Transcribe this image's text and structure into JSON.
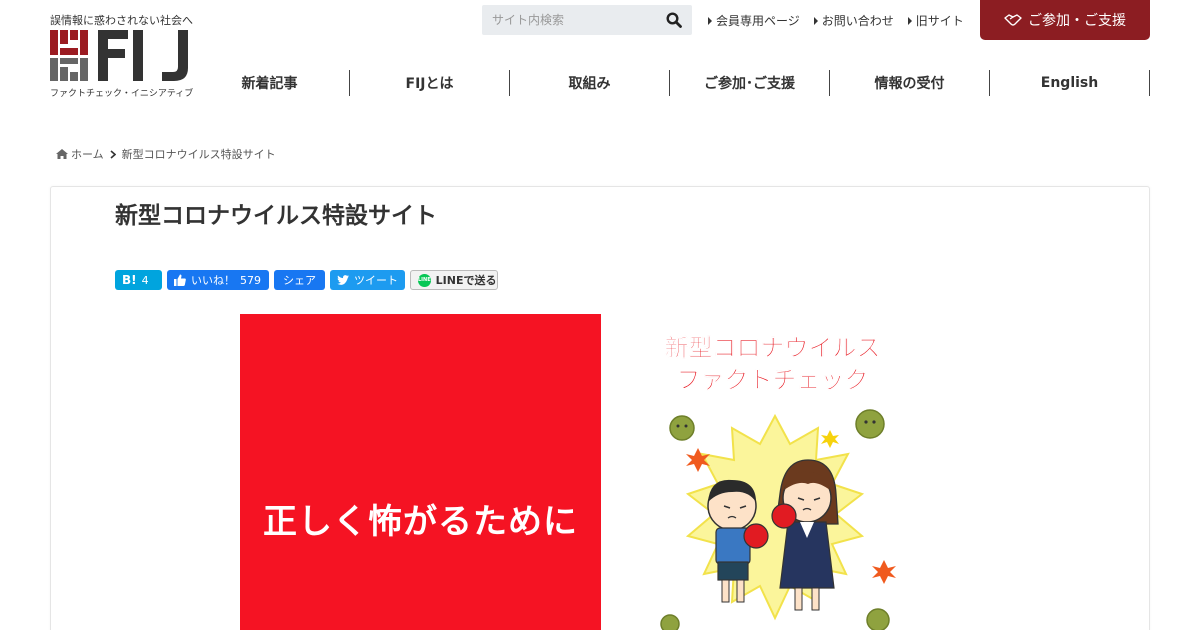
{
  "header": {
    "tagline": "誤情報に惑わされない社会へ",
    "logo_text": "FIJ",
    "logo_subtitle": "ファクトチェック・イニシアティブ",
    "search": {
      "placeholder": "サイト内検索"
    },
    "util_links": [
      "会員専用ページ",
      "お問い合わせ",
      "旧サイト"
    ],
    "join_button": "ご参加・ご支援"
  },
  "nav": [
    "新着記事",
    "FIJとは",
    "取組み",
    "ご参加･ご支援",
    "情報の受付",
    "English"
  ],
  "breadcrumb": {
    "home": "ホーム",
    "current": "新型コロナウイルス特設サイト"
  },
  "page": {
    "title": "新型コロナウイルス特設サイト"
  },
  "share": {
    "hatena_label": "B!",
    "hatena_count": "4",
    "like_label": "いいね！",
    "like_count": "579",
    "share_label": "シェア",
    "tweet_label": "ツイート",
    "line_label": "LINEで送る",
    "line_icon_text": "LINE"
  },
  "hero": {
    "left_text": "正しく怖がるために",
    "heading_line1": "新型コロナウイルス",
    "heading_line2": "ファクトチェック"
  },
  "colors": {
    "brand_red": "#8c1d22",
    "hero_red": "#f51323",
    "hatena": "#00a4de",
    "facebook": "#1877f2",
    "twitter": "#1d9bf0",
    "line": "#06c755"
  }
}
